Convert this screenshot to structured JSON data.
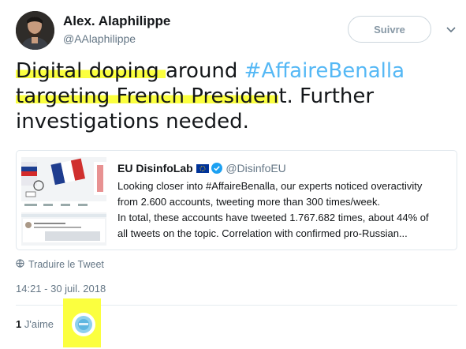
{
  "author": {
    "display_name": "Alex. Alaphilippe",
    "handle": "@AAlaphilippe",
    "avatar_icon": "user-avatar-photo"
  },
  "follow_button": {
    "label": "Suivre"
  },
  "menu": {
    "icon": "chevron-down-icon"
  },
  "tweet": {
    "seg1_hl": "Digital doping ",
    "seg1_rest": "around",
    "hashtag": " #AffaireBenalla",
    "seg2_hl": "targeting French Presiden",
    "seg2_rest": "t. Further",
    "seg3": "investigations needed."
  },
  "quoted": {
    "name": "EU DisinfoLab",
    "handle": "@DisinfoEU",
    "lines": [
      "Looking closer into #AffaireBenalla, our experts noticed overactivity",
      "from 2.600 accounts, tweeting more than 300 times/week.",
      "In total, these accounts have tweeted 1.767.682 times, about 44% of",
      "all tweets on the topic. Correlation with confirmed pro-Russian..."
    ]
  },
  "translate_label": "Traduire le Tweet",
  "timestamp": "14:21 - 30 juil. 2018",
  "likes": {
    "count": "1",
    "label": "J'aime"
  },
  "colors": {
    "highlight": "#fbff3f",
    "hashtag": "#1da1f2",
    "secondary_text": "#657786"
  }
}
